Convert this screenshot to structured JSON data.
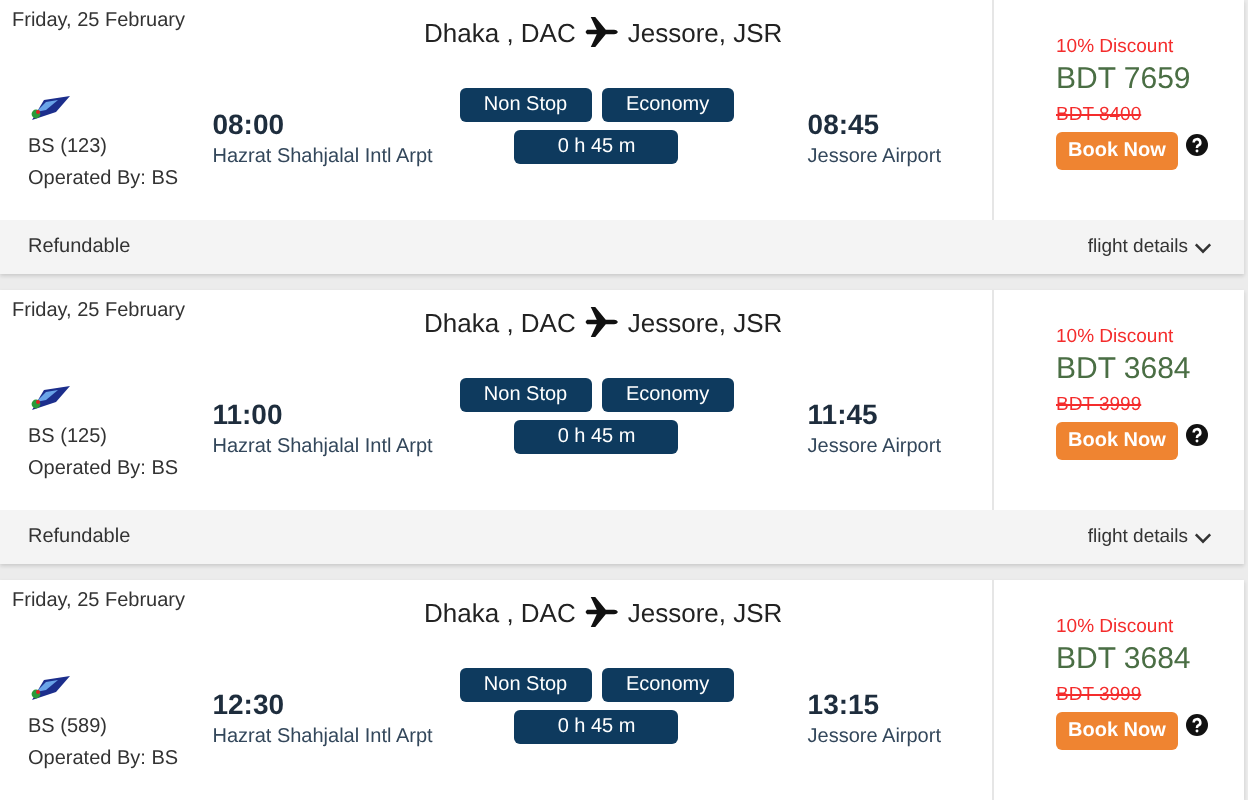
{
  "flights": [
    {
      "date": "Friday, 25 February",
      "origin": "Dhaka , DAC",
      "destination": "Jessore, JSR",
      "flight_no": "BS (123)",
      "operated_by": "Operated By: BS",
      "depart_time": "08:00",
      "depart_airport": "Hazrat Shahjalal Intl Arpt",
      "stops": "Non Stop",
      "cabin": "Economy",
      "duration": "0 h 45 m",
      "arrive_time": "08:45",
      "arrive_airport": "Jessore Airport",
      "discount": "10% Discount",
      "price": "BDT 7659",
      "old_price": "BDT 8400",
      "book": "Book Now",
      "footer": {
        "refund": "Refundable",
        "details": "flight details"
      }
    },
    {
      "date": "Friday, 25 February",
      "origin": "Dhaka , DAC",
      "destination": "Jessore, JSR",
      "flight_no": "BS (125)",
      "operated_by": "Operated By: BS",
      "depart_time": "11:00",
      "depart_airport": "Hazrat Shahjalal Intl Arpt",
      "stops": "Non Stop",
      "cabin": "Economy",
      "duration": "0 h 45 m",
      "arrive_time": "11:45",
      "arrive_airport": "Jessore Airport",
      "discount": "10% Discount",
      "price": "BDT 3684",
      "old_price": "BDT 3999",
      "book": "Book Now",
      "footer": {
        "refund": "Refundable",
        "details": "flight details"
      }
    },
    {
      "date": "Friday, 25 February",
      "origin": "Dhaka , DAC",
      "destination": "Jessore, JSR",
      "flight_no": "BS (589)",
      "operated_by": "Operated By: BS",
      "depart_time": "12:30",
      "depart_airport": "Hazrat Shahjalal Intl Arpt",
      "stops": "Non Stop",
      "cabin": "Economy",
      "duration": "0 h 45 m",
      "arrive_time": "13:15",
      "arrive_airport": "Jessore Airport",
      "discount": "10% Discount",
      "price": "BDT 3684",
      "old_price": "BDT 3999",
      "book": "Book Now"
    }
  ]
}
